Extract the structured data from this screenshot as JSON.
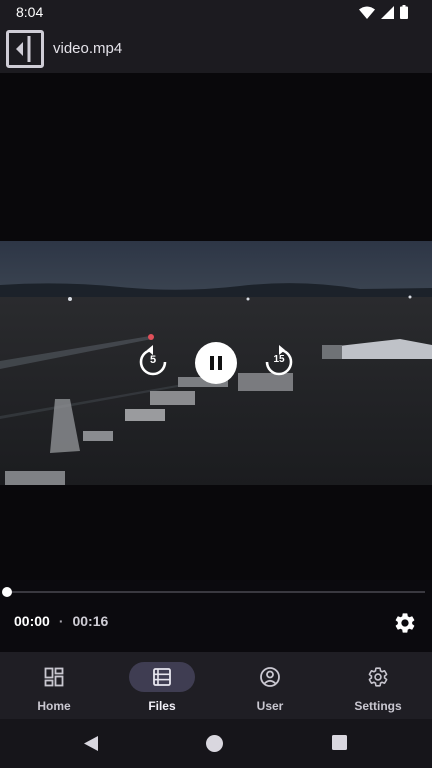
{
  "status_bar": {
    "time": "8:04",
    "icons": [
      "wifi-icon",
      "cell-signal-icon",
      "battery-icon"
    ]
  },
  "app_bar": {
    "title": "video.mp4",
    "back_icon": "collapse-panel-icon"
  },
  "player": {
    "rewind_seconds": "5",
    "forward_seconds": "15",
    "state": "playing",
    "current_time": "00:00",
    "separator": "·",
    "duration": "00:16",
    "progress_fraction": 0.0
  },
  "bottom_nav": {
    "items": [
      {
        "label": "Home",
        "icon": "dashboard-icon",
        "active": false
      },
      {
        "label": "Files",
        "icon": "list-icon",
        "active": true
      },
      {
        "label": "User",
        "icon": "account-circle-icon",
        "active": false
      },
      {
        "label": "Settings",
        "icon": "gear-icon",
        "active": false
      }
    ]
  },
  "colors": {
    "background": "#0b0a0e",
    "bar": "#1c1b20",
    "nav_active_pill": "#3f3d52",
    "text": "#e9e7ee"
  }
}
